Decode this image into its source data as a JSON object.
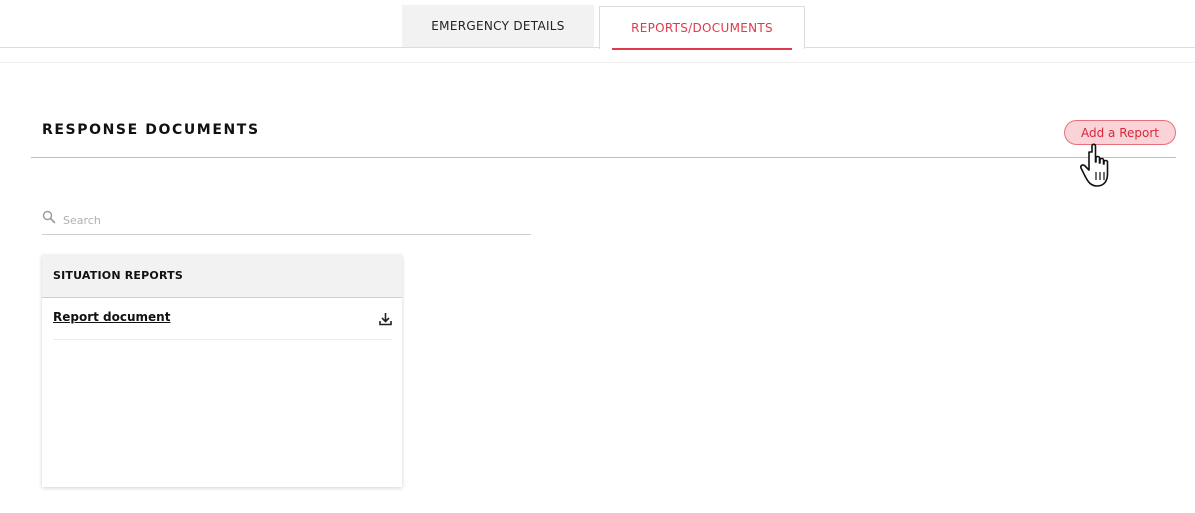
{
  "tabs": [
    {
      "label": "EMERGENCY DETAILS",
      "active": false
    },
    {
      "label": "REPORTS/DOCUMENTS",
      "active": true
    }
  ],
  "section": {
    "title": "RESPONSE DOCUMENTS",
    "add_button_label": "Add a Report"
  },
  "search": {
    "placeholder": "Search",
    "value": ""
  },
  "card": {
    "header": "SITUATION REPORTS",
    "items": [
      {
        "label": "Report document",
        "icon": "download-icon"
      }
    ]
  },
  "colors": {
    "accent": "#e0394b",
    "button_bg": "#f9d3d7",
    "tab_inactive_bg": "#f2f2f2"
  }
}
